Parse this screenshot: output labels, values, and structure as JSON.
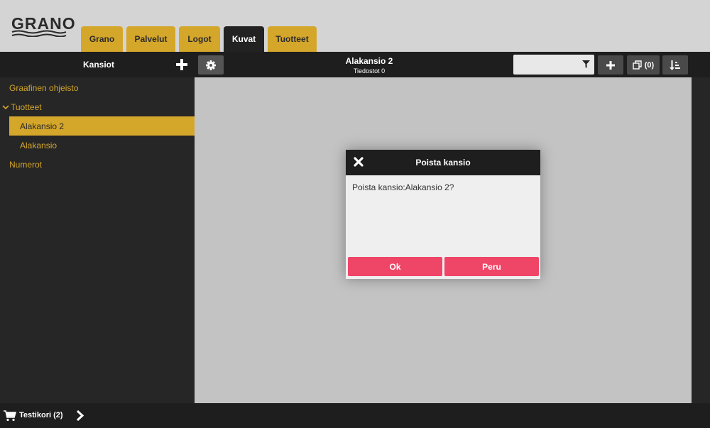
{
  "brand": {
    "logo_text": "GRANO"
  },
  "tabs": [
    {
      "label": "Grano",
      "active": false
    },
    {
      "label": "Palvelut",
      "active": false
    },
    {
      "label": "Logot",
      "active": false
    },
    {
      "label": "Kuvat",
      "active": true
    },
    {
      "label": "Tuotteet",
      "active": false
    }
  ],
  "toolbar": {
    "folders_title": "Kansiot",
    "current_folder": "Alakansio 2",
    "file_count": "Tiedostot 0",
    "filter_placeholder": "",
    "compare_count": "(0)"
  },
  "sidebar": {
    "items": [
      {
        "label": "Graafinen ohjeisto",
        "level": 0,
        "selected": false
      },
      {
        "label": "Tuotteet",
        "level": 0,
        "expanded": true,
        "selected": false
      },
      {
        "label": "Alakansio 2",
        "level": 1,
        "selected": true
      },
      {
        "label": "Alakansio",
        "level": 1,
        "selected": false
      },
      {
        "label": "Numerot",
        "level": 0,
        "selected": false
      }
    ]
  },
  "dialog": {
    "title": "Poista kansio",
    "message": "Poista kansio:Alakansio 2?",
    "ok_label": "Ok",
    "cancel_label": "Peru"
  },
  "footer": {
    "cart_label": "Testikori (2)"
  },
  "colors": {
    "accent": "#d4a62a",
    "dark": "#1e1e1e",
    "danger": "#ef4566",
    "background": "#d4d4d4"
  }
}
